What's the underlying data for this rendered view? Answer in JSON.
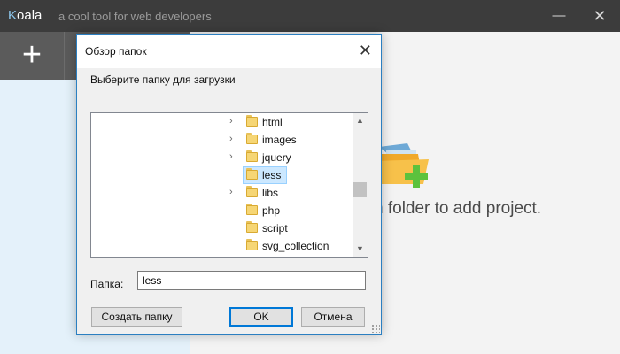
{
  "app": {
    "name_first": "K",
    "name_rest": "oala",
    "tagline": "a cool tool for web developers",
    "minimize_glyph": "—",
    "close_glyph": "✕",
    "add_glyph": "+",
    "empty_hint": "n folder to add project."
  },
  "dialog": {
    "title": "Обзор папок",
    "close_glyph": "✕",
    "description": "Выберите папку для загрузки",
    "tree": {
      "items": [
        {
          "label": "html",
          "arrow": "›",
          "selected": false
        },
        {
          "label": "images",
          "arrow": "›",
          "selected": false
        },
        {
          "label": "jquery",
          "arrow": "›",
          "selected": false
        },
        {
          "label": "less",
          "arrow": "",
          "selected": true
        },
        {
          "label": "libs",
          "arrow": "›",
          "selected": false
        },
        {
          "label": "php",
          "arrow": "",
          "selected": false
        },
        {
          "label": "script",
          "arrow": "",
          "selected": false
        },
        {
          "label": "svg_collection",
          "arrow": "",
          "selected": false
        }
      ],
      "scroll_up_glyph": "▲",
      "scroll_down_glyph": "▼"
    },
    "folder_label": "Папка:",
    "folder_value": "less",
    "buttons": {
      "new_folder": "Создать папку",
      "ok": "OK",
      "cancel": "Отмена"
    }
  },
  "colors": {
    "app_titlebar": "#3c3c3c",
    "toolbar": "#5b5b5b",
    "sidebar": "#e4f1fa",
    "accent": "#0078d7",
    "selection": "#cce8ff"
  },
  "icons": [
    "add-icon",
    "folder-add-icon",
    "folder-icon",
    "chevron-right-icon",
    "close-icon"
  ]
}
